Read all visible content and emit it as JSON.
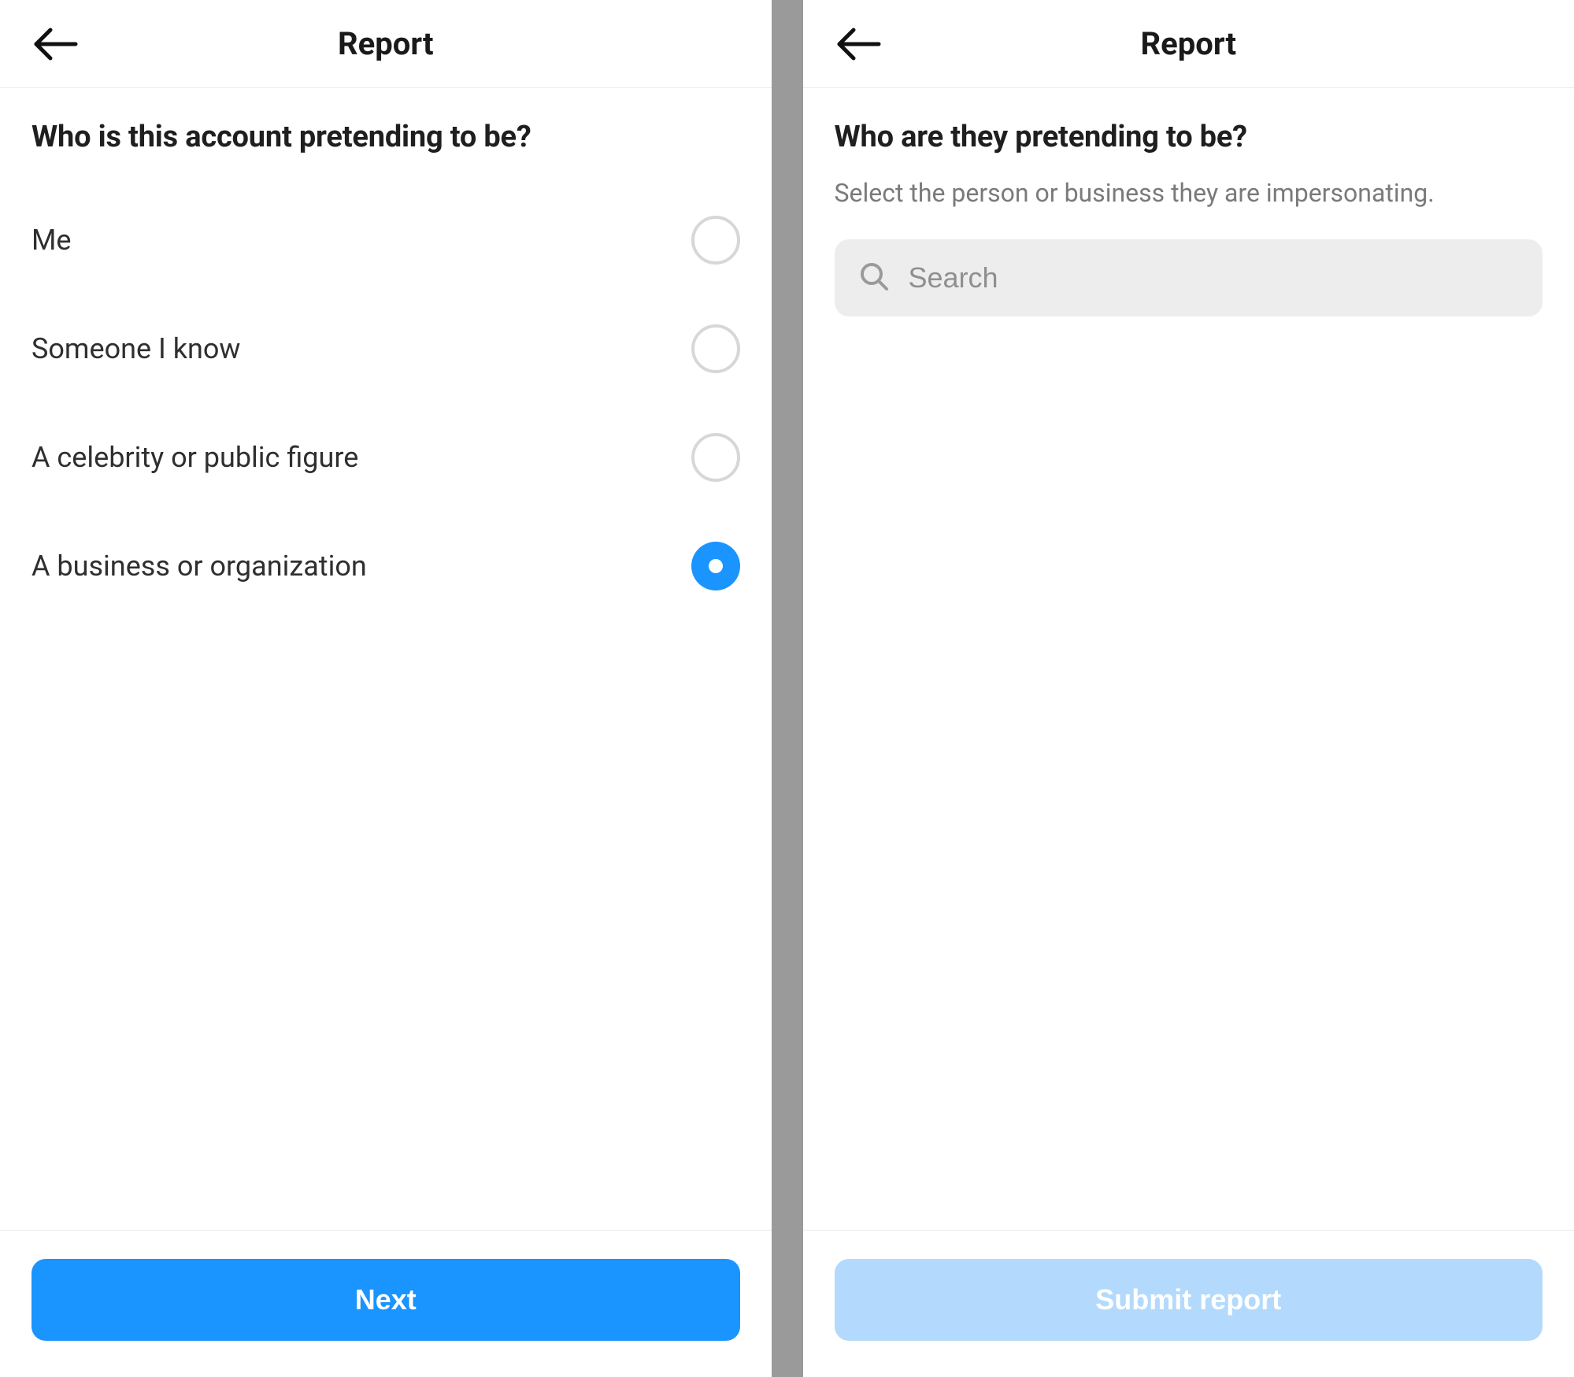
{
  "left": {
    "header": {
      "title": "Report"
    },
    "question": "Who is this account pretending to be?",
    "options": [
      {
        "label": "Me",
        "selected": false
      },
      {
        "label": "Someone I know",
        "selected": false
      },
      {
        "label": "A celebrity or public figure",
        "selected": false
      },
      {
        "label": "A business or organization",
        "selected": true
      }
    ],
    "footer": {
      "button_label": "Next",
      "enabled": true
    }
  },
  "right": {
    "header": {
      "title": "Report"
    },
    "question": "Who are they pretending to be?",
    "subtitle": "Select the person or business they are impersonating.",
    "search": {
      "placeholder": "Search",
      "value": ""
    },
    "footer": {
      "button_label": "Submit report",
      "enabled": false
    }
  }
}
